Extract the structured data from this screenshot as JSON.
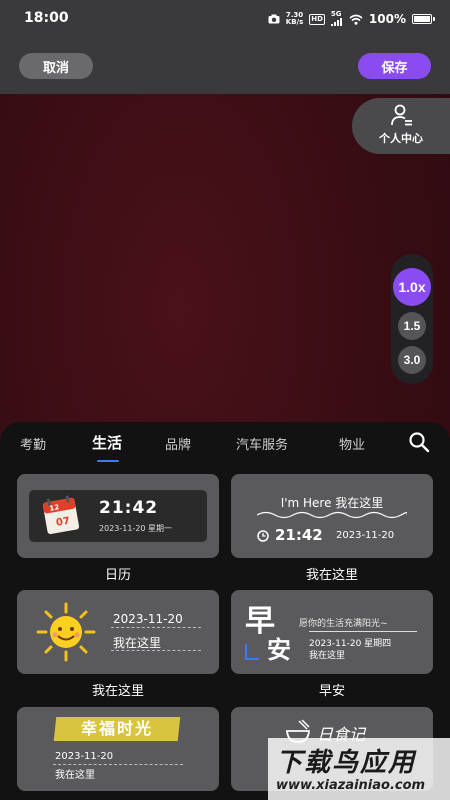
{
  "status": {
    "time": "18:00",
    "net_speed_value": "7.30",
    "net_speed_unit": "KB/s",
    "hd": "HD",
    "signal": "5G",
    "battery": "100%"
  },
  "toolbar": {
    "cancel_label": "取消",
    "save_label": "保存"
  },
  "side": {
    "personal_center": "个人中心"
  },
  "zoom": {
    "levels": [
      "1.0x",
      "1.5",
      "3.0"
    ],
    "active": "1.0x"
  },
  "colors": {
    "accent": "#8a4cf0",
    "tab_indicator": "#3a7bf5",
    "banner": "#d9c440"
  },
  "tabs": [
    {
      "label": "考勤"
    },
    {
      "label": "生活"
    },
    {
      "label": "品牌"
    },
    {
      "label": "汽车服务"
    },
    {
      "label": "物业"
    }
  ],
  "active_tab": "生活",
  "templates": [
    {
      "label": "日历",
      "cal_top": "12",
      "cal_bottom": "07",
      "time": "21:42",
      "date": "2023-11-20  星期一"
    },
    {
      "label": "我在这里",
      "title": "I'm Here 我在这里",
      "time": "21:42",
      "date": "2023-11-20"
    },
    {
      "label": "我在这里",
      "date": "2023-11-20",
      "text": "我在这里"
    },
    {
      "label": "早安",
      "big1": "早",
      "big2": "安",
      "motto": "愿你的生活充满阳光~",
      "date": "2023-11-20  星期四",
      "text": "我在这里"
    },
    {
      "title": "幸福时光",
      "date": "2023-11-20",
      "text": "我在这里"
    },
    {
      "title": "日食记"
    }
  ],
  "watermark": {
    "line1": "下载鸟应用",
    "line2": "www.xiazainiao.com"
  }
}
